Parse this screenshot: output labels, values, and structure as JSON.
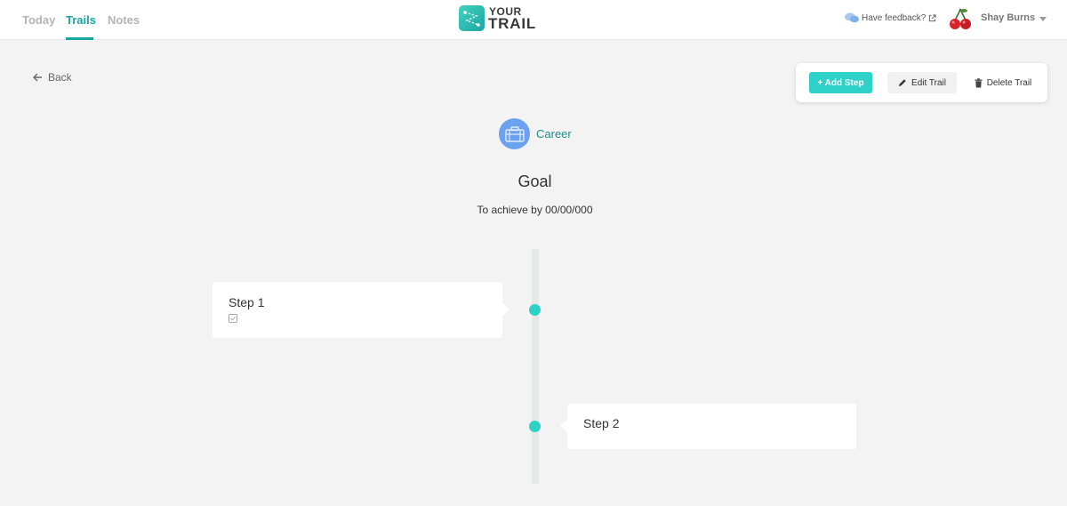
{
  "nav": {
    "tabs": [
      {
        "label": "Today",
        "active": false
      },
      {
        "label": "Trails",
        "active": true
      },
      {
        "label": "Notes",
        "active": false
      }
    ]
  },
  "logo": {
    "line1": "YOUR",
    "line2": "TRAIL"
  },
  "header": {
    "feedback_label": "Have feedback?",
    "user_name": "Shay Burns"
  },
  "back_label": "Back",
  "actions": {
    "add_step": "+ Add Step",
    "edit_trail": "Edit Trail",
    "delete_trail": "Delete Trail"
  },
  "trail": {
    "category": "Career",
    "goal": "Goal",
    "achieve_by": "To achieve by 00/00/000"
  },
  "steps": [
    {
      "title": "Step 1",
      "side": "left",
      "checklist_icon": "checkbox-icon"
    },
    {
      "title": "Step 2",
      "side": "right"
    }
  ],
  "colors": {
    "accent": "#1aa6a0",
    "button": "#2ed1c7",
    "category": "#6aa2f0",
    "background": "#f3f3f3"
  }
}
